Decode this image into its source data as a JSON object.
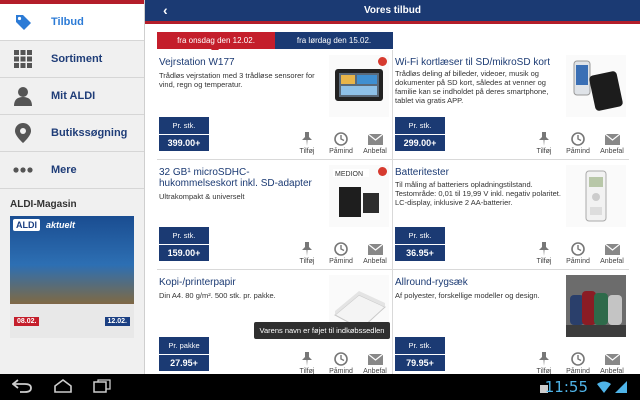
{
  "header": {
    "title": "Vores tilbud",
    "back_icon": "chevron-left-icon"
  },
  "sidebar": {
    "items": [
      {
        "label": "Tilbud",
        "icon": "tag-icon",
        "active": true
      },
      {
        "label": "Sortiment",
        "icon": "grid-icon",
        "active": false
      },
      {
        "label": "Mit ALDI",
        "icon": "person-icon",
        "active": false
      },
      {
        "label": "Butikssøgning",
        "icon": "location-pin-icon",
        "active": false
      },
      {
        "label": "Mere",
        "icon": "more-dots-icon",
        "active": false
      }
    ],
    "magazine_title": "ALDI-Magasin",
    "magazine": {
      "logo": "ALDI",
      "logo_suffix": "aktuelt",
      "date1": "08.02.",
      "date2": "12.02."
    }
  },
  "tabs": [
    {
      "label": "fra onsdag den 12.02.",
      "active": true
    },
    {
      "label": "fra lørdag den 15.02.",
      "active": false
    }
  ],
  "actions": {
    "add": "Tilføj",
    "remind": "Påmind",
    "recommend": "Anbefal"
  },
  "products": [
    {
      "title": "Vejrstation W177",
      "desc": "Trådløs vejrstation med 3 trådløse sensorer for vind, regn og temperatur.",
      "price_label": "Pr. stk.",
      "price": "399.00+"
    },
    {
      "title": "Wi-Fi kortlæser til SD/mikroSD kort",
      "desc": "Trådløs deling af billeder, videoer, musik og dokumenter på SD kort, således at venner og familie kan se indholdet på deres smartphone, tablet via gratis APP.",
      "price_label": "Pr. stk.",
      "price": "299.00+"
    },
    {
      "title": "32 GB¹ microSDHC-hukommelseskort inkl. SD-adapter",
      "desc": "Ultrakompakt & universelt",
      "price_label": "Pr. stk.",
      "price": "159.00+"
    },
    {
      "title": "Batteritester",
      "desc": "Til måling af batteriers opladningstilstand. Testområde: 0,01 til 19,99 V inkl. negativ polaritet. LC-display, inklusive 2 AA-batterier.",
      "price_label": "Pr. stk.",
      "price": "36.95+"
    },
    {
      "title": "Kopi-/printerpapir",
      "desc": "Din A4. 80 g/m². 500 stk. pr. pakke.",
      "price_label": "Pr. pakke",
      "price": "27.95+"
    },
    {
      "title": "Allround-rygsæk",
      "desc": "Af polyester, forskellige modeller og design.",
      "price_label": "Pr. stk.",
      "price": "79.95+"
    }
  ],
  "toast": "Varens navn er føjet til indkøbssedlen",
  "status": {
    "time": "11:55"
  },
  "colors": {
    "navy": "#1b3a73",
    "red": "#c41e2b",
    "accent_blue": "#2c7bd6",
    "clock": "#4fb4e8"
  }
}
